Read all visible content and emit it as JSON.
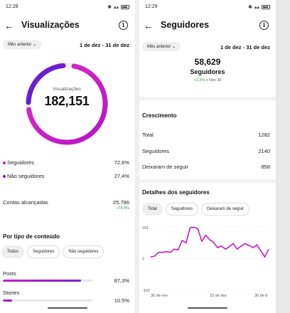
{
  "left": {
    "status_time": "12:28",
    "title": "Visualizações",
    "period_button": "Mês anterior",
    "date_range": "1 de dez - 31 de dez",
    "ring": {
      "label": "Visualizações",
      "value": "182,151",
      "followers_fraction": 0.726
    },
    "breakdown": [
      {
        "label": "Seguidores",
        "value": "72,6%",
        "color": "#c71ac6"
      },
      {
        "label": "Não seguidores",
        "value": "27,4%",
        "color": "#6a1fd0"
      }
    ],
    "reach": {
      "label": "Contas alcançadas",
      "value": "25,786",
      "delta": "+78,4%"
    },
    "by_content_title": "Por tipo de conteúdo",
    "tabs": [
      "Todos",
      "Seguidores",
      "Não seguidores"
    ],
    "content_types": [
      {
        "label": "Posts",
        "value": "87,3%",
        "fraction": 0.873
      },
      {
        "label": "Stories",
        "value": "10.5%",
        "fraction": 0.105
      }
    ]
  },
  "right": {
    "status_time": "12:29",
    "title": "Seguidores",
    "period_button": "Mês anterior",
    "date_range": "1 de dez - 31 de dez",
    "followers_value": "58,629",
    "followers_label": "Seguidores",
    "delta_pct": "+2,3%",
    "delta_suffix": " x Nov 30",
    "growth_title": "Crescimento",
    "growth": [
      {
        "label": "Total",
        "value": "1282"
      },
      {
        "label": "Seguidores",
        "value": "2140"
      },
      {
        "label": "Deixaram de seguir",
        "value": "858"
      }
    ],
    "details_title": "Detalhes dos seguidores",
    "tabs": [
      "Total",
      "Seguidores",
      "Deixaram de seguir"
    ]
  },
  "chart_data": {
    "type": "line",
    "ytick_labels": [
      "101",
      "0",
      "-101"
    ],
    "ylim": [
      -101,
      101
    ],
    "xtick_labels": [
      "30 de nov",
      "15 de dez",
      "30 de d"
    ],
    "series": [
      {
        "color": "#c71ac6",
        "x": [
          1,
          2,
          3,
          4,
          5,
          6,
          7,
          8,
          9,
          10,
          11,
          12,
          13,
          14,
          15,
          16,
          17,
          18,
          19,
          20,
          21,
          22,
          23,
          24,
          25,
          26,
          27,
          28,
          29,
          30,
          31
        ],
        "values": [
          5,
          8,
          20,
          20,
          22,
          20,
          30,
          28,
          58,
          50,
          98,
          100,
          95,
          55,
          75,
          60,
          52,
          35,
          40,
          30,
          38,
          48,
          30,
          40,
          48,
          42,
          35,
          44,
          25,
          5,
          30
        ]
      }
    ]
  }
}
